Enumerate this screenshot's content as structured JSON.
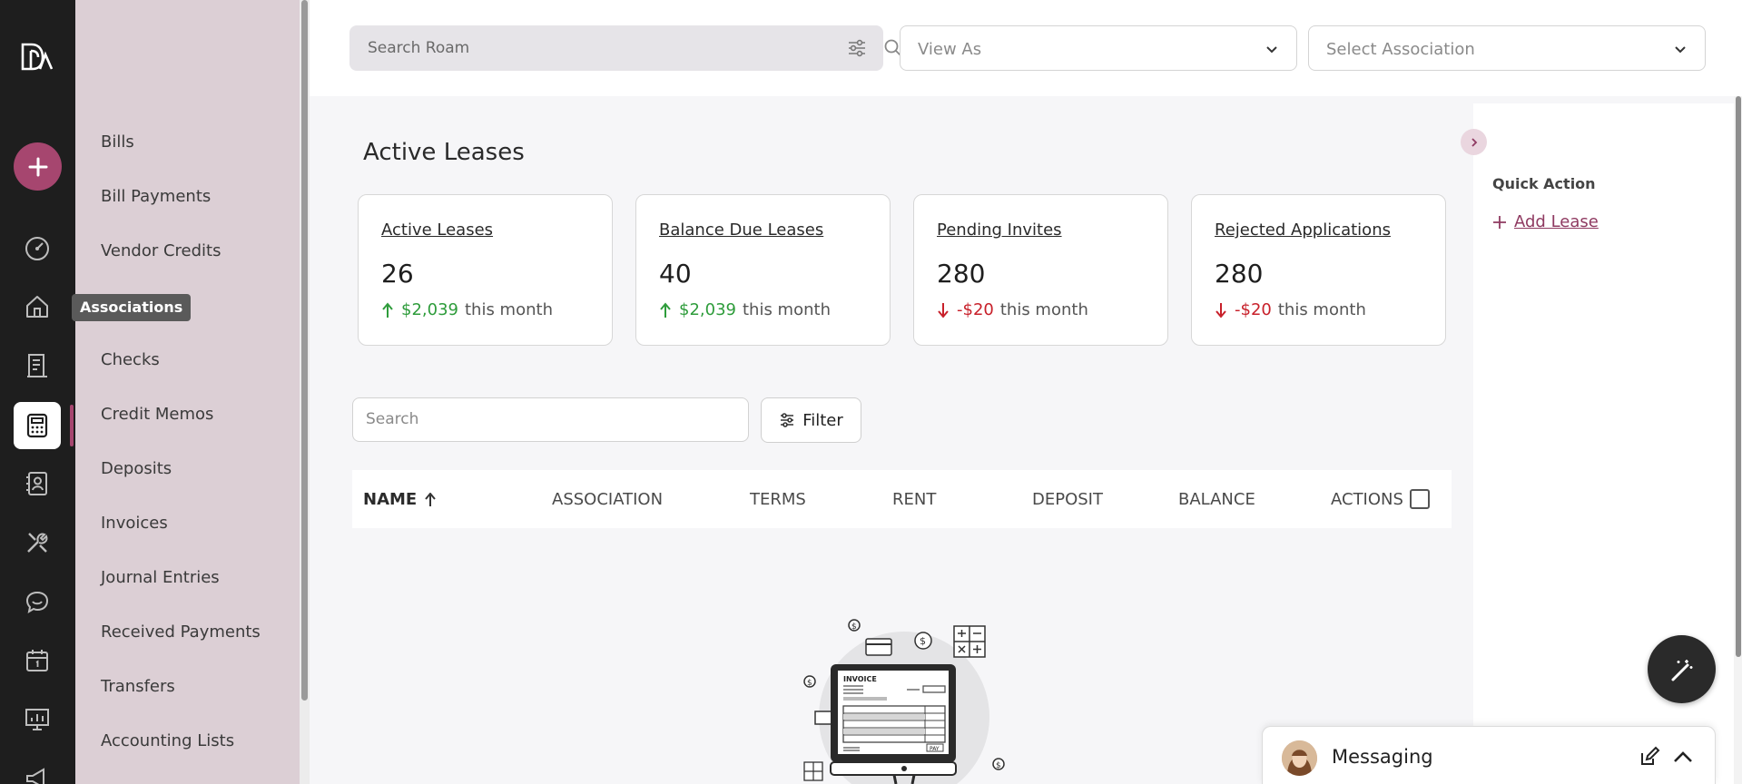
{
  "tooltip": "Associations",
  "subnav": {
    "items": [
      "Bills",
      "Bill Payments",
      "Vendor Credits",
      "Checks",
      "Credit Memos",
      "Deposits",
      "Invoices",
      "Journal Entries",
      "Received Payments",
      "Transfers",
      "Accounting Lists"
    ]
  },
  "topbar": {
    "search_placeholder": "Search Roam",
    "view_as": "View As",
    "select_association": "Select Association"
  },
  "page": {
    "title": "Active Leases"
  },
  "cards": [
    {
      "title": "Active Leases",
      "value": "26",
      "amount": "$2,039",
      "period": "this month",
      "direction": "up"
    },
    {
      "title": "Balance Due Leases",
      "value": "40",
      "amount": "$2,039",
      "period": "this month",
      "direction": "up"
    },
    {
      "title": "Pending Invites",
      "value": "280",
      "amount": "-$20",
      "period": "this month",
      "direction": "down"
    },
    {
      "title": "Rejected Applications",
      "value": "280",
      "amount": "-$20",
      "period": "this month",
      "direction": "down"
    }
  ],
  "table": {
    "search_placeholder": "Search",
    "filter_label": "Filter",
    "columns": [
      "NAME",
      "ASSOCIATION",
      "TERMS",
      "RENT",
      "DEPOSIT",
      "BALANCE",
      "ACTIONS"
    ]
  },
  "illustration": {
    "invoice_label": "INVOICE",
    "pay_label": "PAY"
  },
  "quick_action": {
    "title": "Quick Action",
    "add_lease": "Add Lease"
  },
  "messaging": {
    "label": "Messaging"
  },
  "colors": {
    "accent": "#a6466f",
    "up": "#2e9c3b",
    "down": "#c8202a",
    "rail": "#1e1e1e",
    "subnav": "#dccfd5"
  }
}
